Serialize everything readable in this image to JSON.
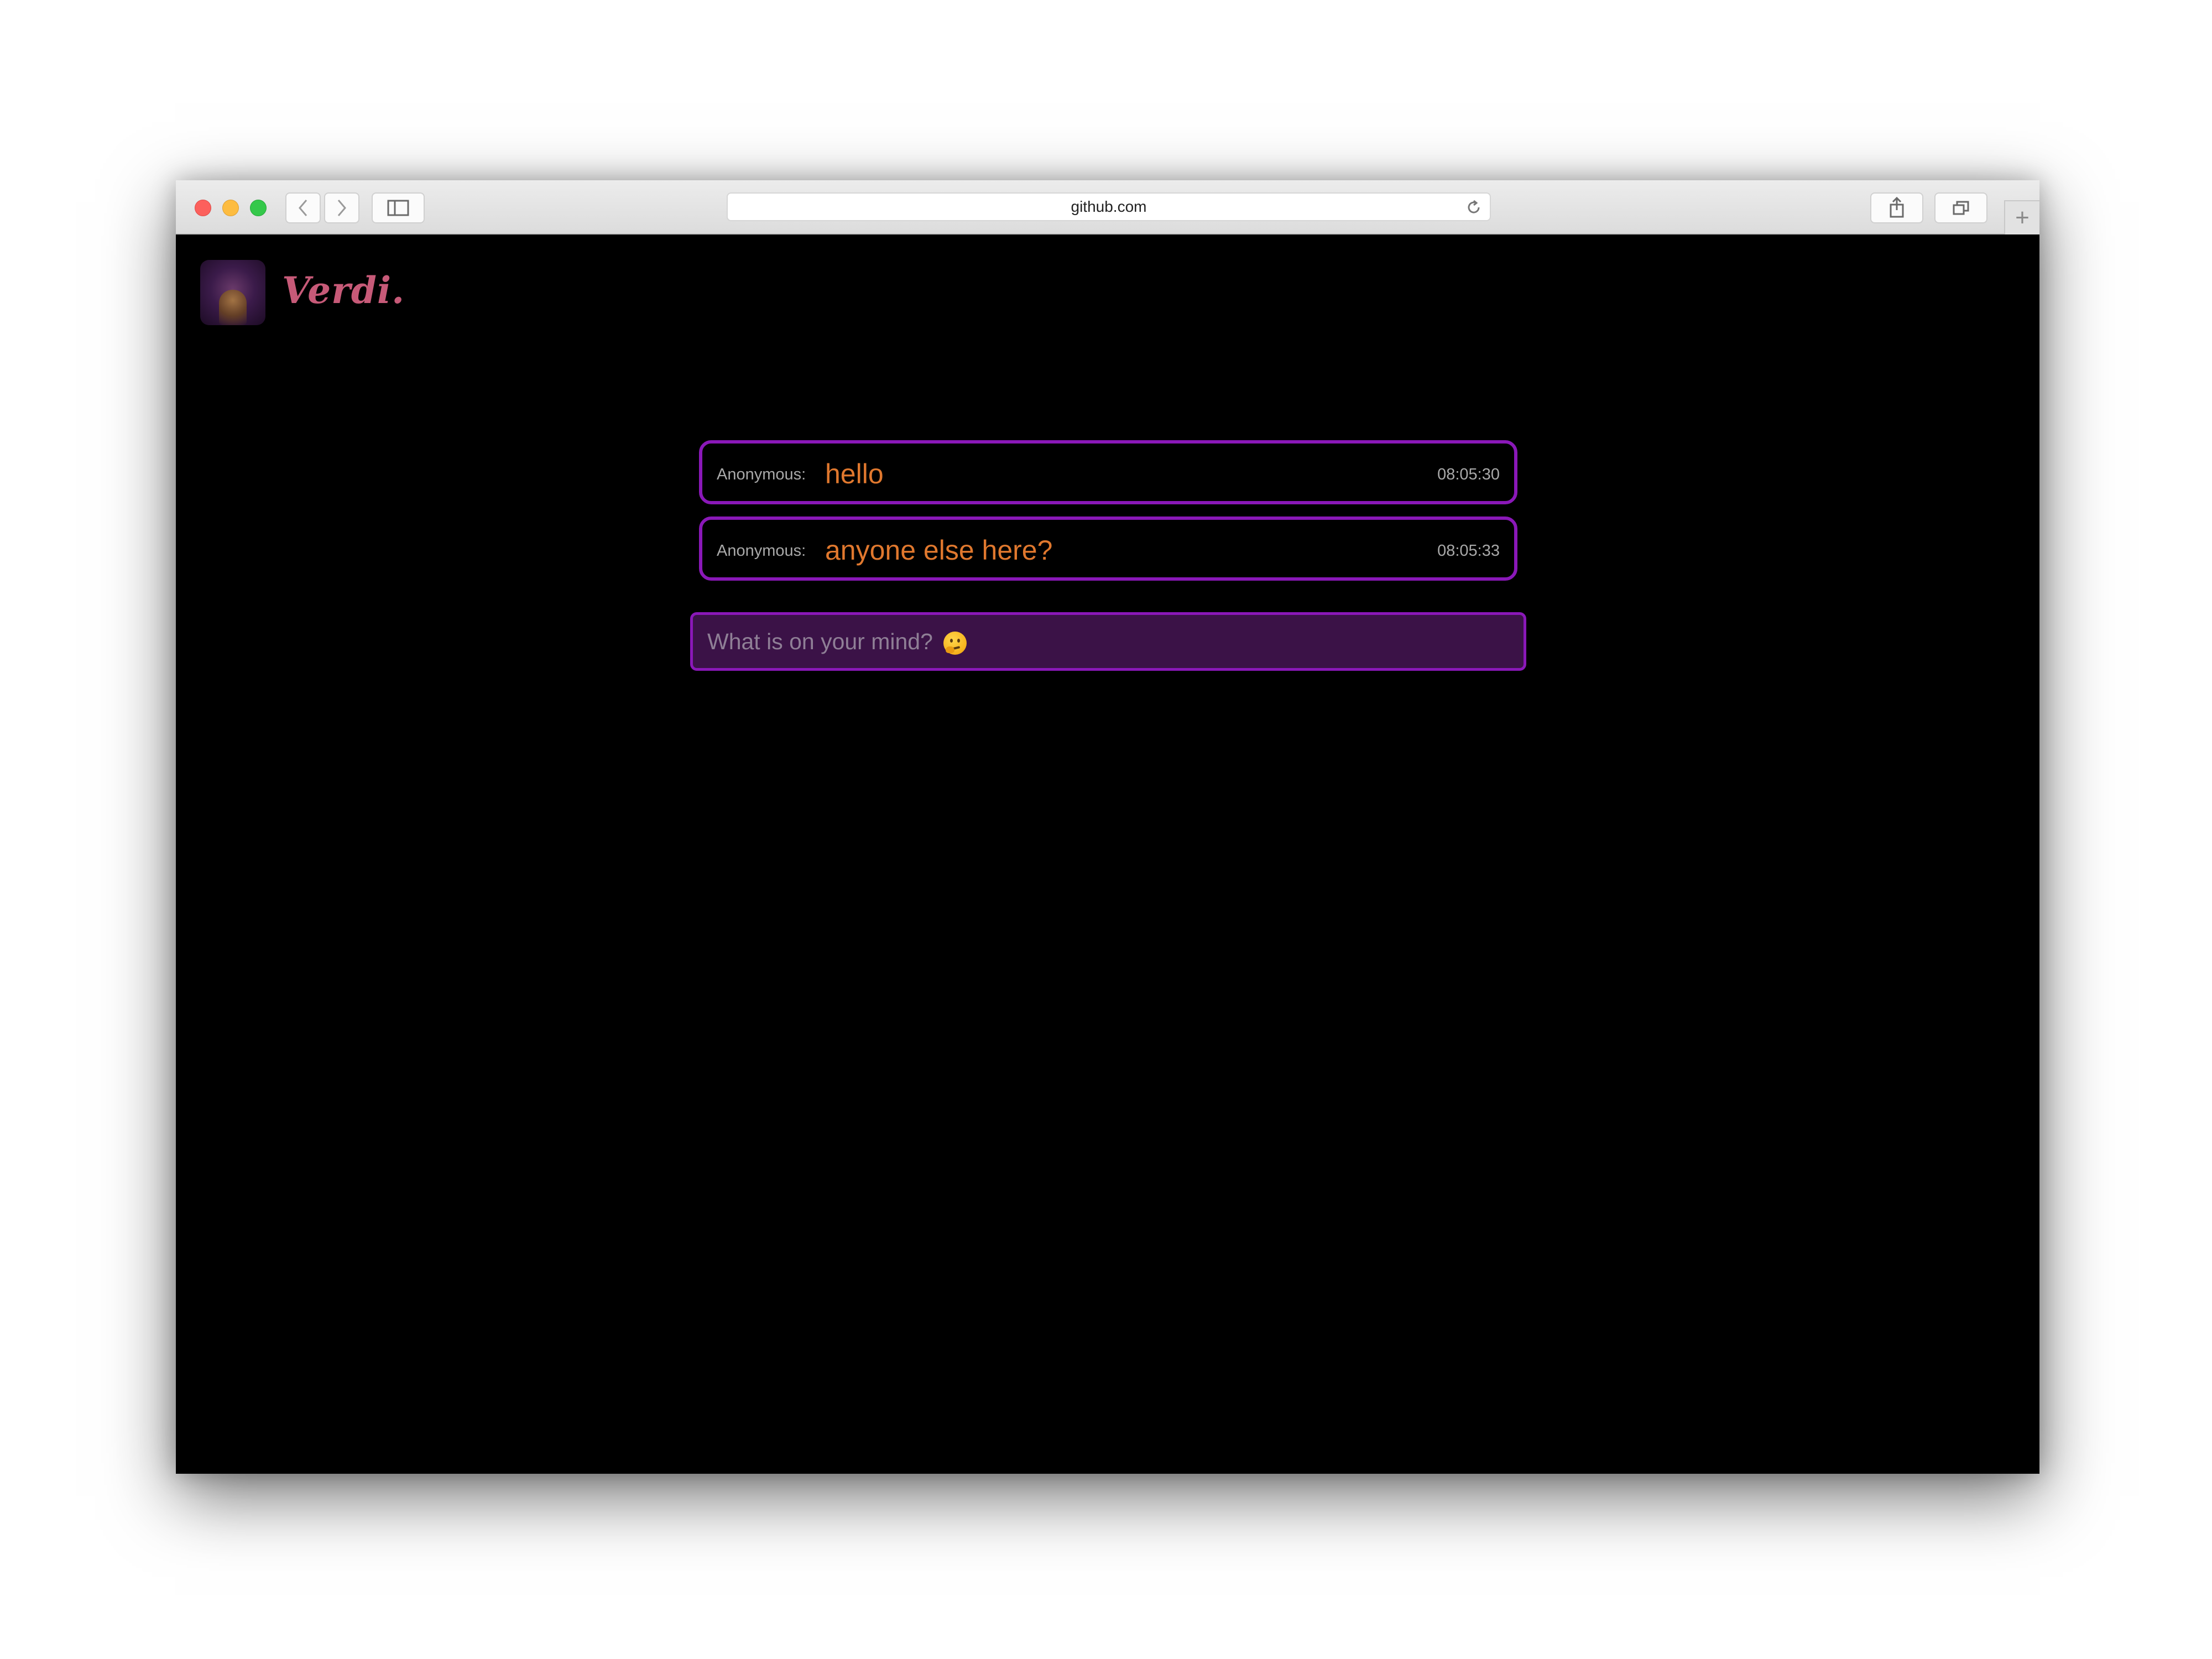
{
  "browser": {
    "url": "github.com",
    "icons": {
      "back": "chevron-left-icon",
      "forward": "chevron-right-icon",
      "sidebar": "sidebar-icon",
      "reload": "reload-icon",
      "share": "share-icon",
      "tabs": "tabs-icon",
      "new_tab": "plus-icon"
    },
    "new_tab_label": "+"
  },
  "app": {
    "brand": "Verdi.",
    "accent_color": "#8a18b8",
    "message_text_color": "#e0782e"
  },
  "messages": [
    {
      "author": "Anonymous:",
      "text": "hello",
      "time": "08:05:30"
    },
    {
      "author": "Anonymous:",
      "text": "anyone else here?",
      "time": "08:05:33"
    }
  ],
  "composer": {
    "placeholder": "What is on your mind?",
    "emoji": "thinking-face-icon"
  }
}
